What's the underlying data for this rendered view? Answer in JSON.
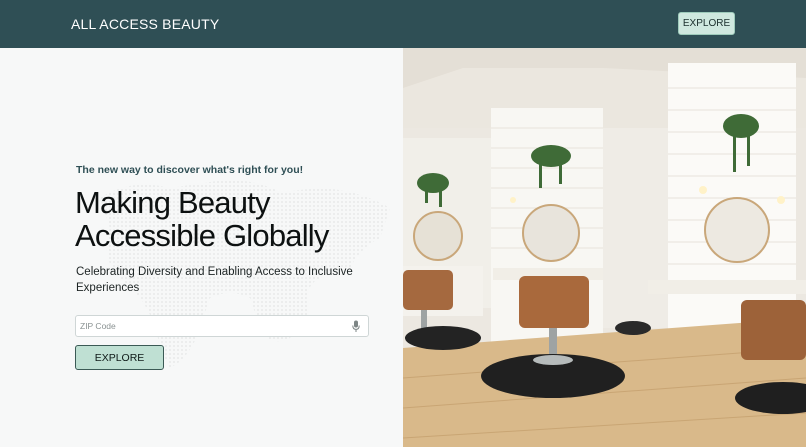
{
  "header": {
    "brand": "ALL ACCESS BEAUTY",
    "explore_label": "EXPLORE"
  },
  "hero": {
    "tagline": "The new way to discover what's right for you!",
    "headline_line1": "Making Beauty",
    "headline_line2": "Accessible Globally",
    "subtext": "Celebrating Diversity and Enabling Access to Inclusive Experiences",
    "search_placeholder": "ZIP Code",
    "search_value": "",
    "explore_label": "EXPLORE"
  },
  "image": {
    "alt": "Hair salon interior with styling chairs, round mirrors and hanging plants"
  },
  "colors": {
    "header_bg": "#2f4f55",
    "accent_mint": "#cfe8df",
    "page_bg": "#f7f8f8"
  },
  "icons": {
    "search_field_icon": "microphone-icon"
  }
}
